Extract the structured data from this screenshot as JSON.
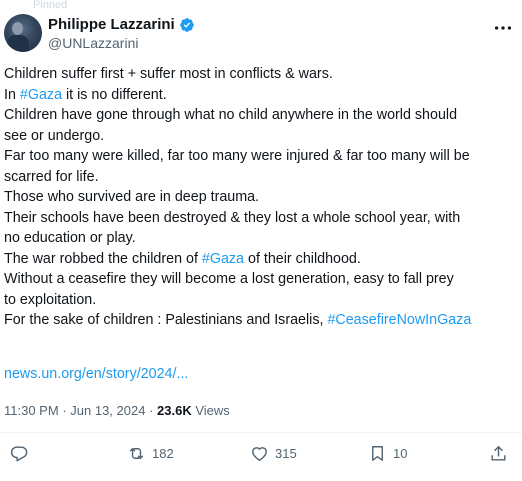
{
  "top_hint": "Pinned",
  "author": {
    "display_name": "Philippe Lazzarini",
    "handle": "@UNLazzarini"
  },
  "tweet": {
    "lines": [
      [
        {
          "t": "Children suffer first + suffer most in conflicts & wars."
        }
      ],
      [
        {
          "t": "In "
        },
        {
          "t": "#Gaza",
          "tag": true
        },
        {
          "t": " it is no different."
        }
      ],
      [
        {
          "t": "Children have gone through what no child anywhere in the world should"
        }
      ],
      [
        {
          "t": "see or undergo."
        }
      ],
      [
        {
          "t": "Far too many were killed, far too many were injured & far too many will be"
        }
      ],
      [
        {
          "t": "scarred for life."
        }
      ],
      [
        {
          "t": "Those who survived are in deep trauma."
        }
      ],
      [
        {
          "t": "Their schools have been destroyed & they lost a whole school year, with"
        }
      ],
      [
        {
          "t": "no education or play."
        }
      ],
      [
        {
          "t": "The war robbed the children of "
        },
        {
          "t": "#Gaza",
          "tag": true
        },
        {
          "t": " of their childhood."
        }
      ],
      [
        {
          "t": "Without a ceasefire they will become a lost generation, easy to fall prey"
        }
      ],
      [
        {
          "t": "to exploitation."
        }
      ],
      [
        {
          "t": "For the sake of children : Palestinians and Israelis, "
        },
        {
          "t": "#CeasefireNowInGaza",
          "tag": true
        }
      ]
    ],
    "link": "news.un.org/en/story/2024/..."
  },
  "meta": {
    "time": "11:30 PM",
    "date": "Jun 13, 2024",
    "views_count": "23.6K",
    "views_label": "Views"
  },
  "actions": {
    "reply_count": "",
    "retweet_count": "182",
    "like_count": "315",
    "bookmark_count": "10"
  },
  "colors": {
    "accent": "#1d9bf0",
    "muted": "#536471",
    "text": "#0f1419"
  }
}
